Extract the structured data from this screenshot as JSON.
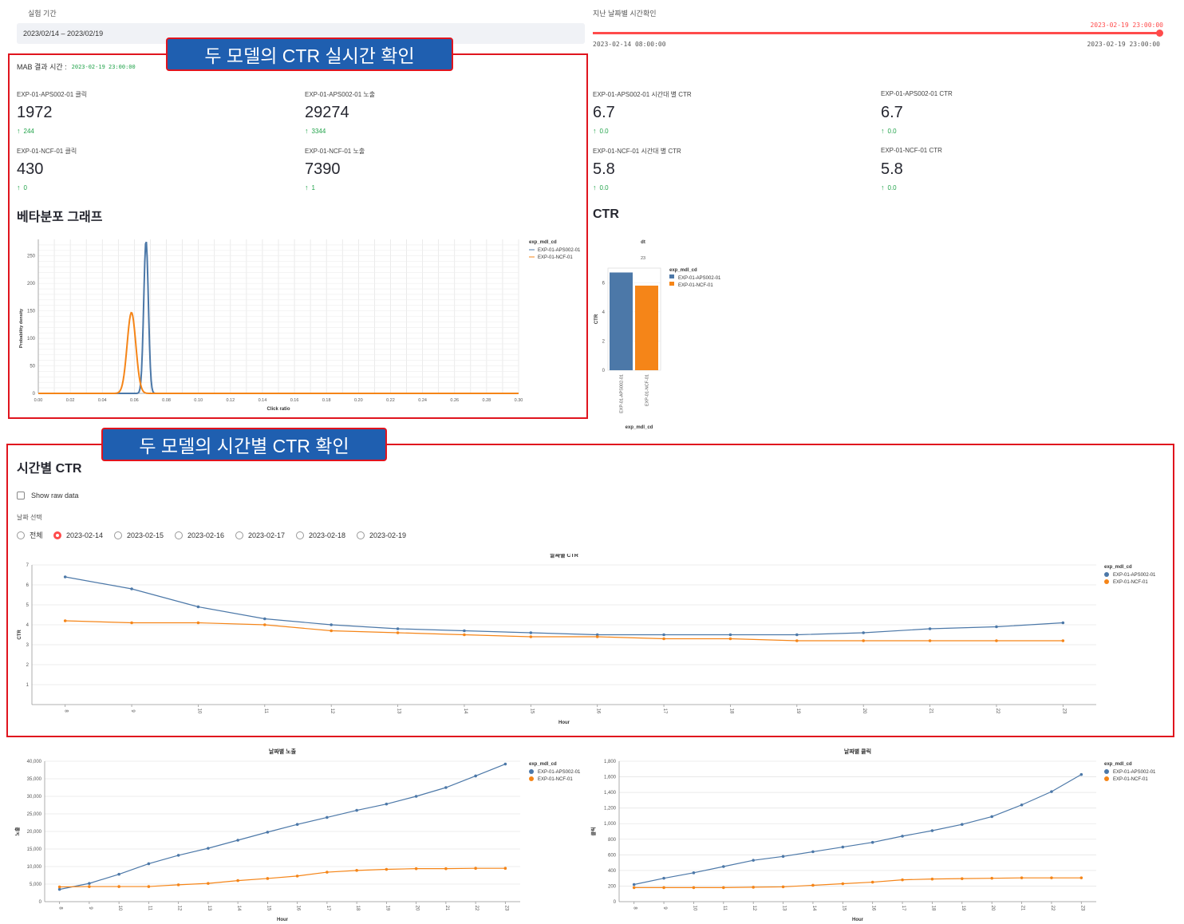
{
  "sidebar_top": {
    "period_label": "실험 기간",
    "period_value": "2023/02/14 – 2023/02/19",
    "slider_label": "지난 날짜별 시간확인",
    "slider_current": "2023-02-19 23:00:00",
    "slider_min": "2023-02-14 08:00:00",
    "slider_max": "2023-02-19 23:00:00",
    "slider_value": 1.0
  },
  "callouts": {
    "realtime": "두 모델의 CTR 실시간 확인",
    "hourly": "두 모델의 시간별 CTR 확인"
  },
  "mab": {
    "label": "MAB 결과 시간 :",
    "time": "2023-02-19 23:00:00"
  },
  "metrics": [
    {
      "label": "EXP-01-APS002-01 클릭",
      "value": "1972",
      "delta": "244"
    },
    {
      "label": "EXP-01-APS002-01 노출",
      "value": "29274",
      "delta": "3344"
    },
    {
      "label": "EXP-01-APS002-01 시간대 별 CTR",
      "value": "6.7",
      "delta": "0.0"
    },
    {
      "label": "EXP-01-APS002-01 CTR",
      "value": "6.7",
      "delta": "0.0"
    },
    {
      "label": "EXP-01-NCF-01 클릭",
      "value": "430",
      "delta": "0"
    },
    {
      "label": "EXP-01-NCF-01 노출",
      "value": "7390",
      "delta": "1"
    },
    {
      "label": "EXP-01-NCF-01 시간대 별 CTR",
      "value": "5.8",
      "delta": "0.0"
    },
    {
      "label": "EXP-01-NCF-01 CTR",
      "value": "5.8",
      "delta": "0.0"
    }
  ],
  "beta_section_title": "베타분포 그래프",
  "ctr_section_title": "CTR",
  "hourly_section": {
    "title": "시간별 CTR",
    "raw_data_label": "Show raw data",
    "date_select_label": "날짜 선택",
    "date_options": [
      "전체",
      "2023-02-14",
      "2023-02-15",
      "2023-02-16",
      "2023-02-17",
      "2023-02-18",
      "2023-02-19"
    ],
    "selected_index": 1
  },
  "colors": {
    "blue": "#4c78a8",
    "orange": "#f58518",
    "red": "#e0141e",
    "callout_bg": "#1f5fb0",
    "delta_green": "#21a34a"
  },
  "chart_data": [
    {
      "id": "beta",
      "type": "line",
      "xlabel": "Click ratio",
      "ylabel": "Probability density",
      "legend_title": "exp_mdl_cd",
      "xlim": [
        0,
        0.3
      ],
      "ylim": [
        0,
        280
      ],
      "xticks": [
        "0.00",
        "0.02",
        "0.04",
        "0.06",
        "0.08",
        "0.10",
        "0.12",
        "0.14",
        "0.16",
        "0.18",
        "0.20",
        "0.22",
        "0.24",
        "0.26",
        "0.28",
        "0.30"
      ],
      "yticks": [
        0,
        50,
        100,
        150,
        200,
        250
      ],
      "series": [
        {
          "name": "EXP-01-APS002-01",
          "mean": 0.0673,
          "peak": 278,
          "sd": 0.00144
        },
        {
          "name": "EXP-01-NCF-01",
          "mean": 0.0582,
          "peak": 147,
          "sd": 0.00272
        }
      ]
    },
    {
      "id": "ctr_bar",
      "type": "bar",
      "facet_title": "dt",
      "facet_value": "23",
      "xlabel": "exp_mdl_cd",
      "ylabel": "CTR",
      "legend_title": "exp_mdl_cd",
      "ylim": [
        0,
        7
      ],
      "yticks": [
        0,
        2,
        4,
        6
      ],
      "categories": [
        "EXP-01-APS002-01",
        "EXP-01-NCF-01"
      ],
      "values": [
        6.7,
        5.8
      ]
    },
    {
      "id": "hourly_ctr",
      "type": "line",
      "title": "날짜별 CTR",
      "xlabel": "Hour",
      "ylabel": "CTR",
      "legend_title": "exp_mdl_cd",
      "ylim": [
        0,
        7
      ],
      "yticks": [
        1,
        2,
        3,
        4,
        5,
        6,
        7
      ],
      "x": [
        8,
        9,
        10,
        11,
        12,
        13,
        14,
        15,
        16,
        17,
        18,
        19,
        20,
        21,
        22,
        23
      ],
      "series": [
        {
          "name": "EXP-01-APS002-01",
          "values": [
            6.4,
            5.8,
            4.9,
            4.3,
            4.0,
            3.8,
            3.7,
            3.6,
            3.5,
            3.5,
            3.5,
            3.5,
            3.6,
            3.8,
            3.9,
            4.1
          ]
        },
        {
          "name": "EXP-01-NCF-01",
          "values": [
            4.2,
            4.1,
            4.1,
            4.0,
            3.7,
            3.6,
            3.5,
            3.4,
            3.4,
            3.3,
            3.3,
            3.2,
            3.2,
            3.2,
            3.2,
            3.2
          ]
        }
      ]
    },
    {
      "id": "hourly_imp",
      "type": "line",
      "title": "날짜별 노출",
      "xlabel": "Hour",
      "ylabel": "노출",
      "legend_title": "exp_mdl_cd",
      "ylim": [
        0,
        40000
      ],
      "yticks": [
        0,
        5000,
        10000,
        15000,
        20000,
        25000,
        30000,
        35000,
        40000
      ],
      "ytick_labels": [
        "0",
        "5,000",
        "10,000",
        "15,000",
        "20,000",
        "25,000",
        "30,000",
        "35,000",
        "40,000"
      ],
      "x": [
        8,
        9,
        10,
        11,
        12,
        13,
        14,
        15,
        16,
        17,
        18,
        19,
        20,
        21,
        22,
        23
      ],
      "series": [
        {
          "name": "EXP-01-APS002-01",
          "values": [
            3500,
            5200,
            7800,
            10800,
            13200,
            15200,
            17500,
            19800,
            22000,
            24000,
            26000,
            27800,
            30000,
            32500,
            35800,
            39200
          ]
        },
        {
          "name": "EXP-01-NCF-01",
          "values": [
            4200,
            4300,
            4300,
            4300,
            4800,
            5200,
            6000,
            6600,
            7300,
            8400,
            8900,
            9200,
            9400,
            9400,
            9500,
            9500
          ]
        }
      ]
    },
    {
      "id": "hourly_click",
      "type": "line",
      "title": "날짜별 클릭",
      "xlabel": "Hour",
      "ylabel": "클릭",
      "legend_title": "exp_mdl_cd",
      "ylim": [
        0,
        1800
      ],
      "yticks": [
        0,
        200,
        400,
        600,
        800,
        1000,
        1200,
        1400,
        1600,
        1800
      ],
      "ytick_labels": [
        "0",
        "200",
        "400",
        "600",
        "800",
        "1,000",
        "1,200",
        "1,400",
        "1,600",
        "1,800"
      ],
      "x": [
        8,
        9,
        10,
        11,
        12,
        13,
        14,
        15,
        16,
        17,
        18,
        19,
        20,
        21,
        22,
        23
      ],
      "series": [
        {
          "name": "EXP-01-APS002-01",
          "values": [
            220,
            300,
            370,
            450,
            530,
            580,
            640,
            700,
            760,
            840,
            910,
            990,
            1090,
            1240,
            1410,
            1630
          ]
        },
        {
          "name": "EXP-01-NCF-01",
          "values": [
            180,
            180,
            180,
            180,
            185,
            190,
            210,
            230,
            250,
            280,
            290,
            295,
            300,
            305,
            305,
            305
          ]
        }
      ]
    }
  ]
}
